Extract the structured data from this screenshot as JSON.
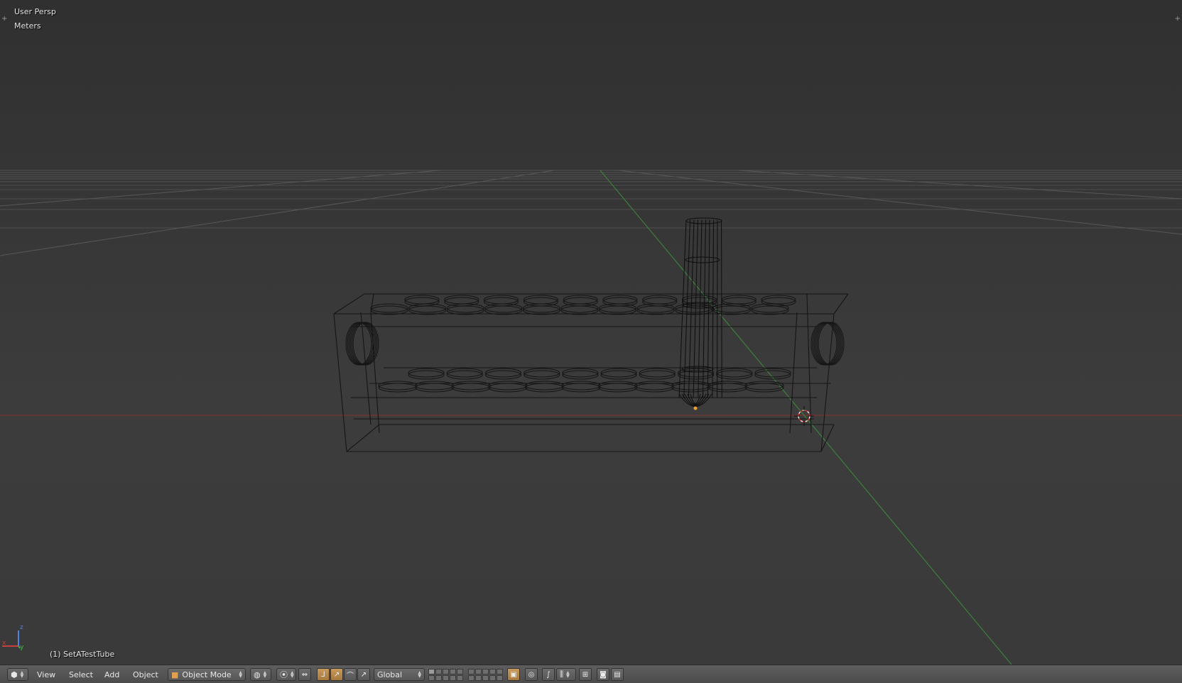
{
  "viewport": {
    "view_label": "User Persp",
    "units_label": "Meters",
    "active_object": "(1) SetATestTube",
    "axis_x_color": "#b03434",
    "axis_y_color": "#3c9c3c",
    "axis_gizmo": {
      "x": "x",
      "y": "y",
      "z": "z"
    }
  },
  "toolbar": {
    "editor_type_icon": "3d-view-icon",
    "menus": [
      "View",
      "Select",
      "Add",
      "Object"
    ],
    "mode": "Object Mode",
    "orientation": "Global",
    "accent_color": "#c8904c"
  }
}
